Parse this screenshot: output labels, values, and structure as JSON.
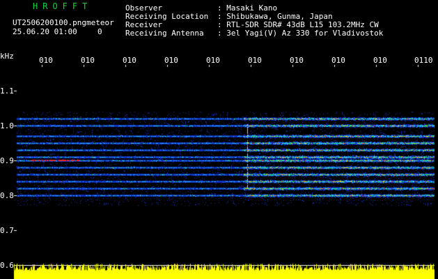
{
  "header": {
    "logo_text": "HROFFT",
    "filename": "UT2506200100.png",
    "meteor_label": "meteor",
    "datetime": "25.06.20 01:00",
    "meteor_count": "0",
    "observer_label": "Observer",
    "observer_value": ": Masaki Kano",
    "location_label": "Receiving Location",
    "location_value": ": Shibukawa, Gunma, Japan",
    "receiver_label": "Receiver",
    "receiver_value": ": RTL-SDR SDR# 43dB L15 103.2MHz CW",
    "antenna_label": "Receiving Antenna",
    "antenna_value": ": 3el Yagi(V) Az 330 for Vladivostok"
  },
  "axis": {
    "y_unit": "kHz",
    "y_ticks": [
      "1.1",
      "1.0",
      "0.9",
      "0.8",
      "0.7",
      "0.6"
    ],
    "x_ticks": [
      "010",
      "010",
      "010",
      "010",
      "010",
      "010",
      "010",
      "010",
      "010",
      "0110"
    ]
  },
  "colors": {
    "background": "#000000",
    "text": "#ffffff",
    "logo": "#19d23a",
    "level_bar": "#ffff00",
    "noise_blue": "#1030d0",
    "signal_red": "#ff2020"
  },
  "bands_khz": [
    1.02,
    1.0,
    0.97,
    0.95,
    0.93,
    0.91,
    0.9,
    0.88,
    0.86,
    0.84,
    0.82,
    0.8
  ]
}
